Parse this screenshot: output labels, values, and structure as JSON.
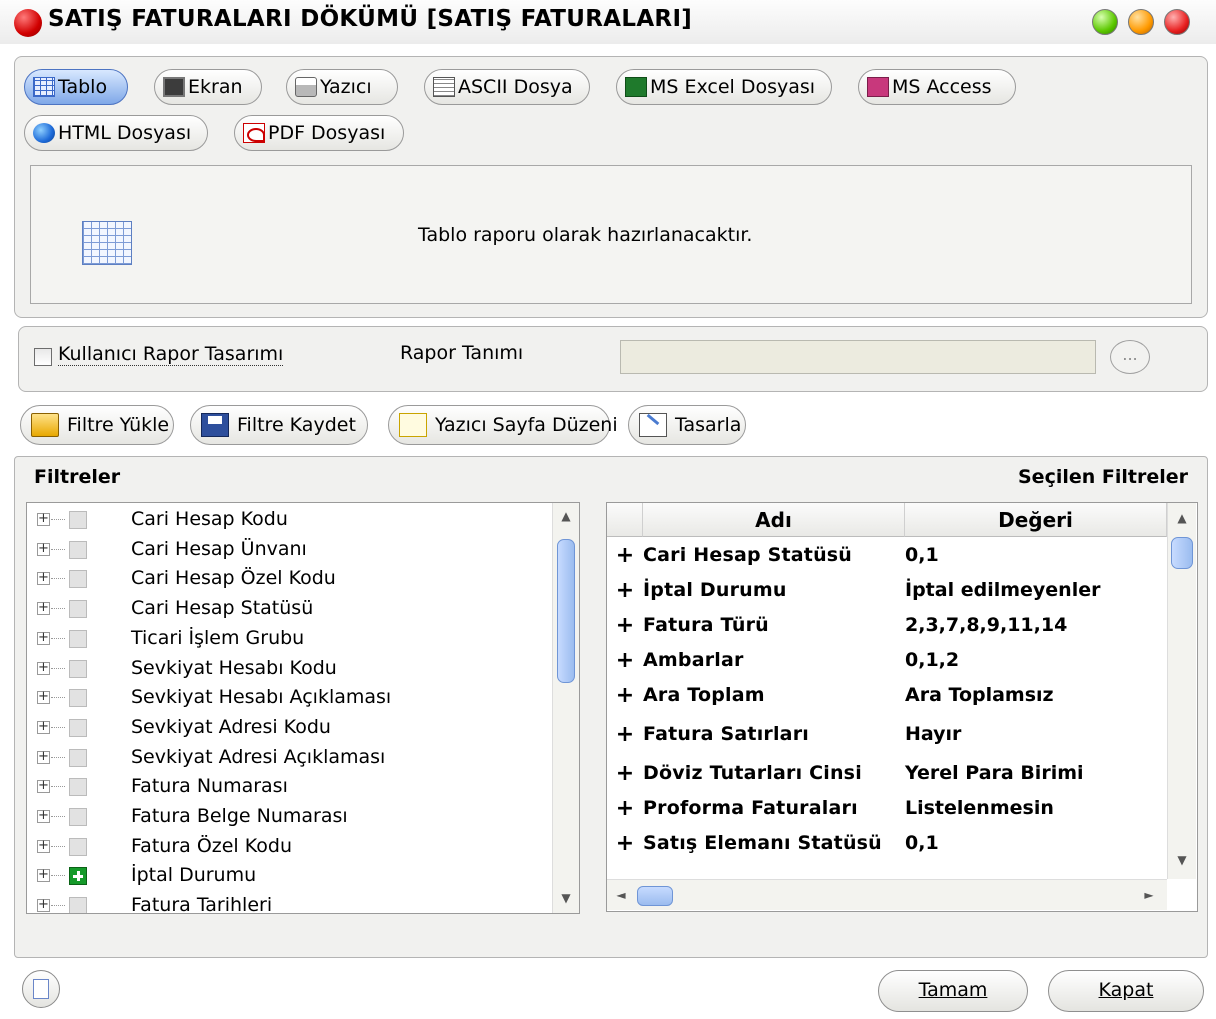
{
  "window": {
    "title": "SATIŞ FATURALARI DÖKÜMÜ [SATIŞ FATURALARI]"
  },
  "output": {
    "options": [
      {
        "label": "Tablo",
        "icon": "table-icon",
        "selected": true
      },
      {
        "label": "Ekran",
        "icon": "monitor-icon"
      },
      {
        "label": "Yazıcı",
        "icon": "printer-icon"
      },
      {
        "label": "ASCII Dosya",
        "icon": "text-file-icon"
      },
      {
        "label": "MS Excel Dosyası",
        "icon": "excel-icon"
      },
      {
        "label": "MS Access",
        "icon": "access-icon"
      },
      {
        "label": "HTML Dosyası",
        "icon": "globe-icon"
      },
      {
        "label": "PDF Dosyası",
        "icon": "pdf-icon"
      }
    ],
    "description": "Tablo raporu olarak hazırlanacaktır."
  },
  "report": {
    "user_design_label": "Kullanıcı Rapor Tasarımı",
    "user_design_checked": false,
    "definition_label": "Rapor Tanımı",
    "definition_value": "",
    "browse_label": "..."
  },
  "toolbar": {
    "load_filter": "Filtre Yükle",
    "save_filter": "Filtre Kaydet",
    "page_setup": "Yazıcı Sayfa Düzeni",
    "design": "Tasarla"
  },
  "filters": {
    "heading": "Filtreler",
    "items": [
      {
        "label": "Cari Hesap Kodu",
        "checked": false
      },
      {
        "label": "Cari Hesap Ünvanı",
        "checked": false
      },
      {
        "label": "Cari Hesap Özel Kodu",
        "checked": false
      },
      {
        "label": "Cari Hesap Statüsü",
        "checked": false
      },
      {
        "label": "Ticari İşlem Grubu",
        "checked": false
      },
      {
        "label": "Sevkiyat Hesabı Kodu",
        "checked": false
      },
      {
        "label": "Sevkiyat Hesabı Açıklaması",
        "checked": false
      },
      {
        "label": "Sevkiyat Adresi Kodu",
        "checked": false
      },
      {
        "label": "Sevkiyat Adresi Açıklaması",
        "checked": false
      },
      {
        "label": "Fatura Numarası",
        "checked": false
      },
      {
        "label": "Fatura Belge Numarası",
        "checked": false
      },
      {
        "label": "Fatura Özel Kodu",
        "checked": false
      },
      {
        "label": "İptal Durumu",
        "checked": true
      },
      {
        "label": "Fatura Tarihleri",
        "checked": false
      }
    ]
  },
  "selected_filters": {
    "heading": "Seçilen Filtreler",
    "columns": [
      "Adı",
      "Değeri"
    ],
    "rows": [
      {
        "name": "Cari Hesap Statüsü",
        "value": "0,1"
      },
      {
        "name": "İptal Durumu",
        "value": "İptal edilmeyenler"
      },
      {
        "name": "Fatura Türü",
        "value": "2,3,7,8,9,11,14"
      },
      {
        "name": "Ambarlar",
        "value": "0,1,2"
      },
      {
        "name": "Ara Toplam",
        "value": "Ara Toplamsız"
      },
      {
        "name": "Fatura Satırları",
        "value": "Hayır"
      },
      {
        "name": "Döviz Tutarları Cinsi",
        "value": "Yerel Para Birimi"
      },
      {
        "name": "Proforma Faturaları",
        "value": "Listelenmesin"
      },
      {
        "name": "Satış Elemanı Statüsü",
        "value": "0,1"
      }
    ]
  },
  "footer": {
    "ok": "Tamam",
    "close": "Kapat"
  }
}
